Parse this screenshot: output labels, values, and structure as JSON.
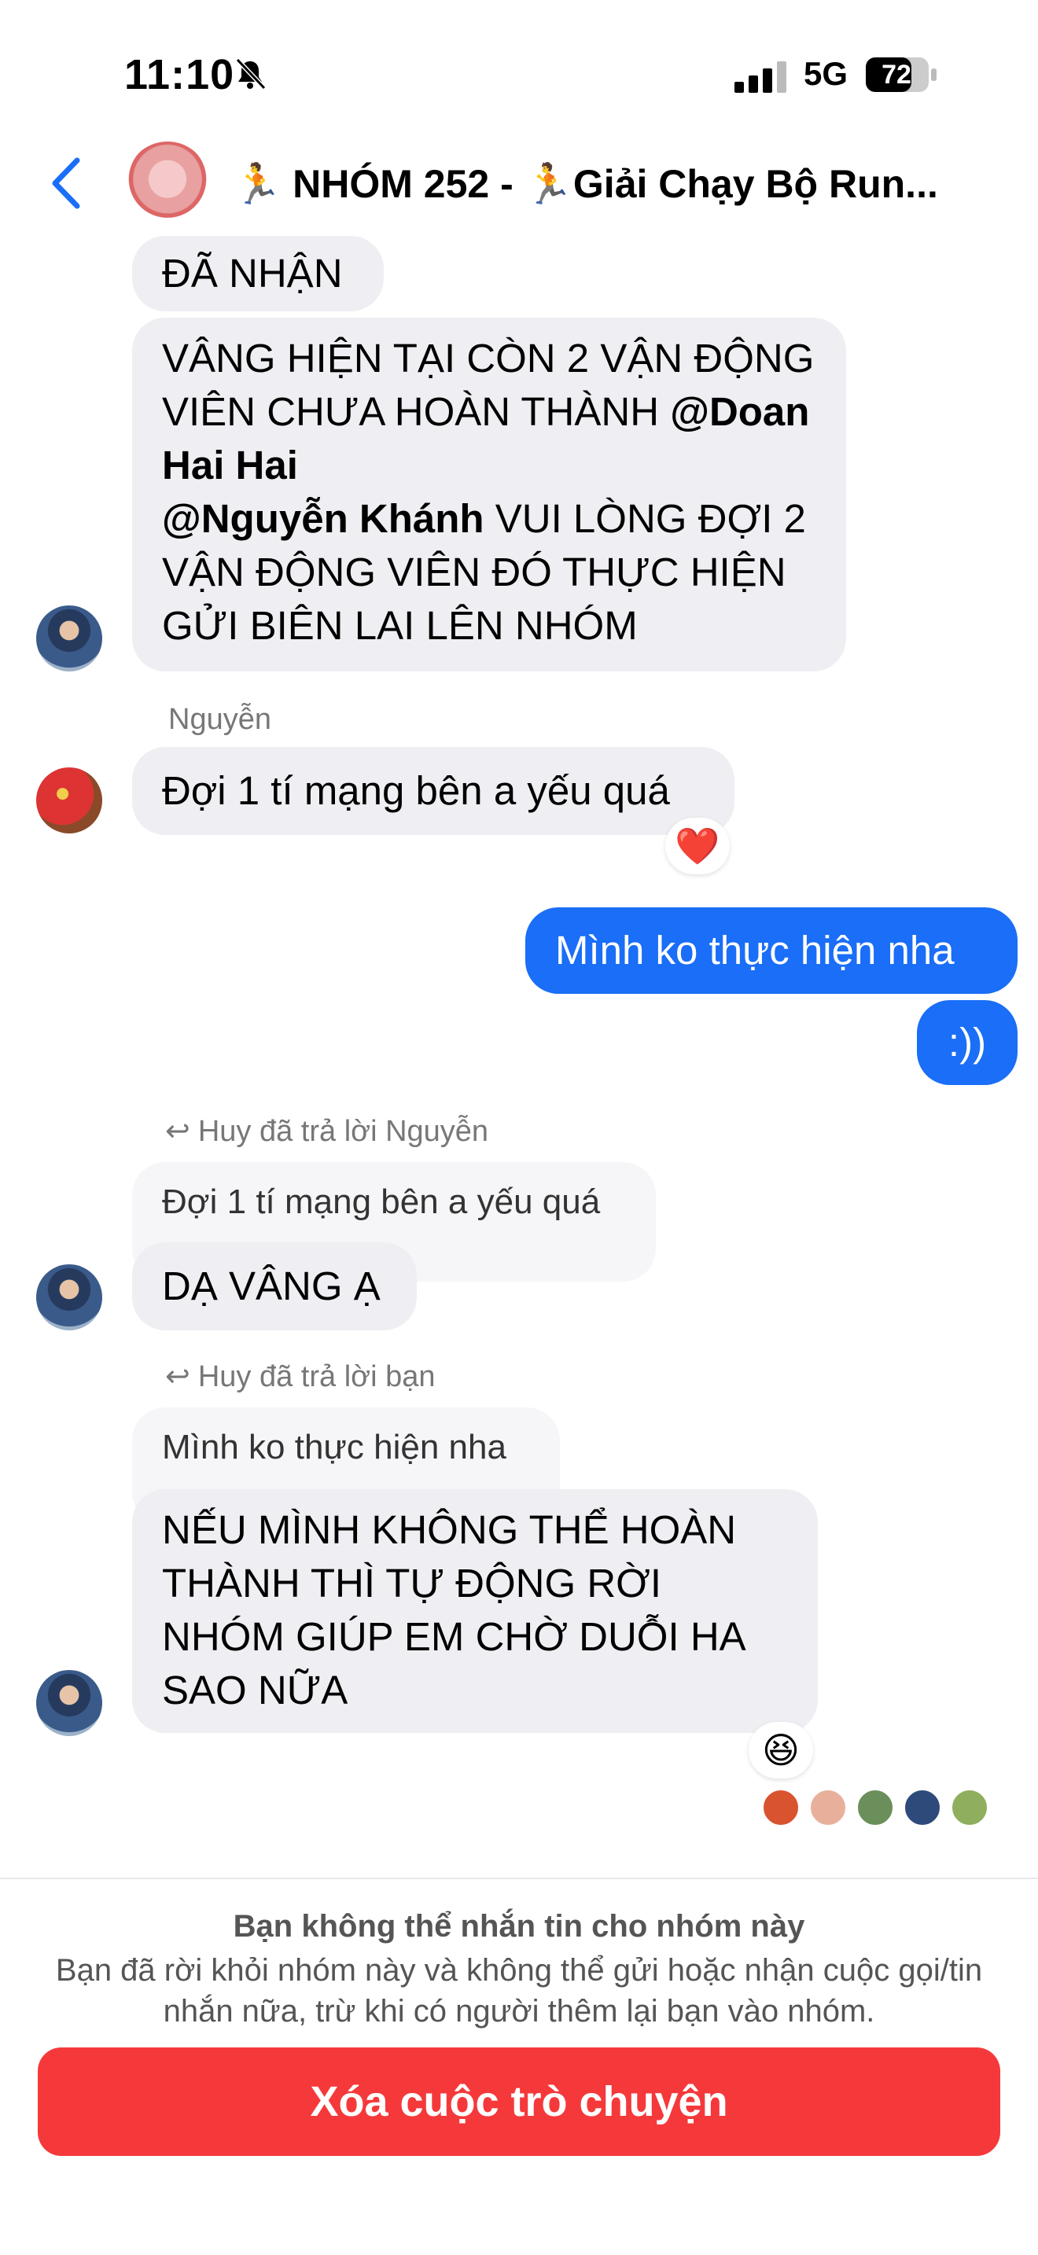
{
  "status_bar": {
    "time": "11:10",
    "network": "5G",
    "battery": "72"
  },
  "header": {
    "title": "🏃 NHÓM 252 - 🏃Giải Chạy Bộ Run...",
    "back_icon": "chevron-left-icon"
  },
  "messages": {
    "m1": "ĐÃ NHẬN",
    "m2": {
      "part1": "VÂNG HIỆN TẠI CÒN 2 VẬN ĐỘNG VIÊN CHƯA HOÀN THÀNH ",
      "mention1": "@Doan Hai Hai",
      "mention2": "@Nguyễn Khánh",
      "part2": " VUI LÒNG ĐỢI 2 VẬN ĐỘNG VIÊN ĐÓ THỰC HIỆN GỬI BIÊN LAI LÊN NHÓM"
    },
    "m3": {
      "sender": "Nguyễn",
      "text": "Đợi 1 tí mạng bên a yếu quá",
      "reaction": "❤️"
    },
    "m4": "Mình ko thực hiện nha",
    "m5": ":))",
    "m6": {
      "reply_label": "Huy đã trả lời Nguyễn",
      "quote": "Đợi 1 tí mạng bên a yếu quá",
      "text": "DẠ VÂNG Ạ"
    },
    "m7": {
      "reply_label": "Huy đã trả lời bạn",
      "quote": "Mình ko thực hiện nha",
      "text": "NẾU MÌNH KHÔNG THỂ HOÀN THÀNH THÌ TỰ ĐỘNG RỜI NHÓM GIÚP EM CHỜ DUỖI HA SAO NỮA",
      "reaction": "😆"
    }
  },
  "footer": {
    "title": "Bạn không thể nhắn tin cho nhóm này",
    "description": "Bạn đã rời khỏi nhóm này và không thể gửi hoặc nhận cuộc gọi/tin nhắn nữa, trừ khi có người thêm lại bạn vào nhóm.",
    "delete_button": "Xóa cuộc trò chuyện"
  },
  "colors": {
    "accent": "#1a6ef7",
    "danger": "#f5393b",
    "bubble_in": "#efeff3"
  }
}
